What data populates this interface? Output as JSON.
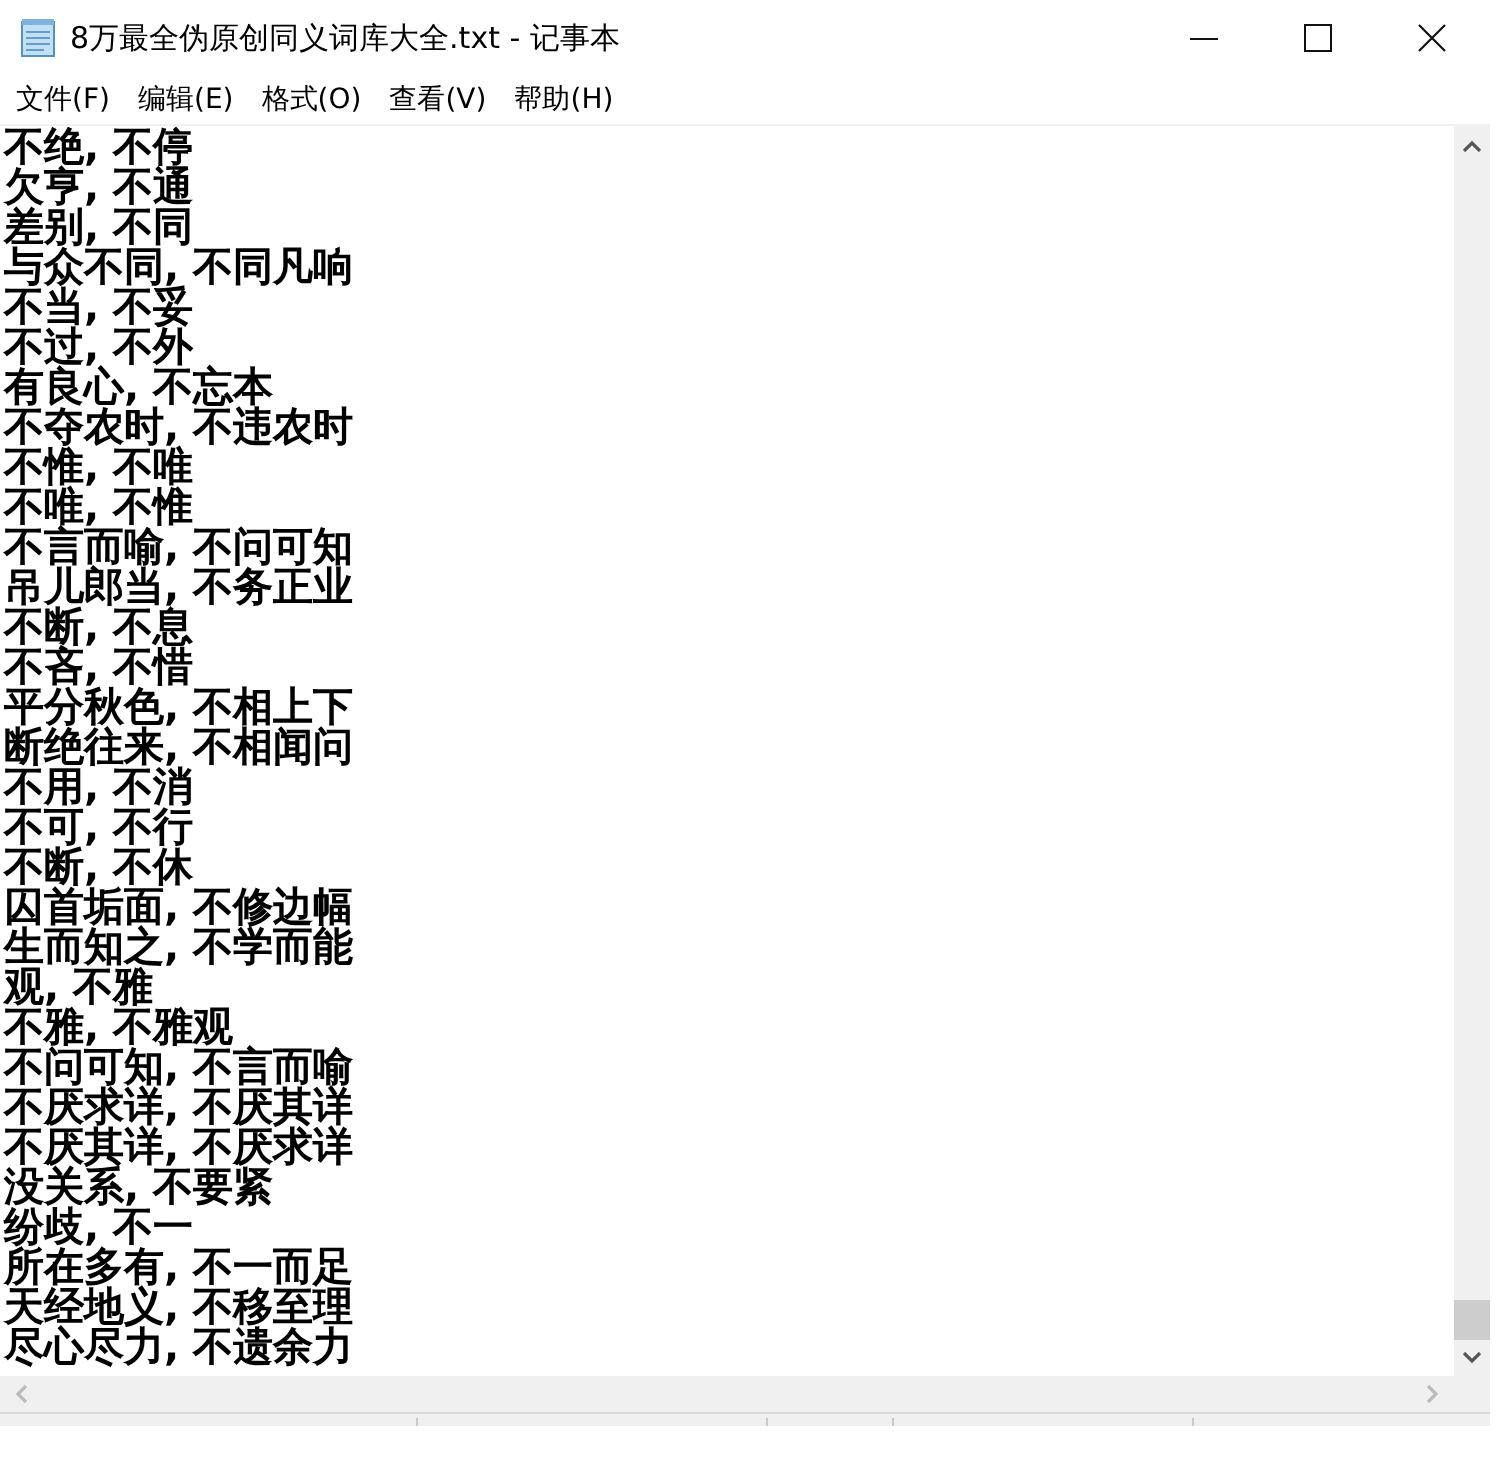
{
  "window": {
    "title": "8万最全伪原创同义词库大全.txt - 记事本"
  },
  "menu": [
    "文件(F)",
    "编辑(E)",
    "格式(O)",
    "查看(V)",
    "帮助(H)"
  ],
  "lines": [
    "不绝, 不停",
    "欠亨, 不通",
    "差别, 不同",
    "与众不同, 不同凡响",
    "不当, 不妥",
    "不过, 不外",
    "有良心, 不忘本",
    "不夺农时, 不违农时",
    "不惟, 不唯",
    "不唯, 不惟",
    "不言而喻, 不问可知",
    "吊儿郎当, 不务正业",
    "不断, 不息",
    "不吝, 不惜",
    "平分秋色, 不相上下",
    "断绝往来, 不相闻问",
    "不用, 不消",
    "不可, 不行",
    "不断, 不休",
    "囚首垢面, 不修边幅",
    "生而知之, 不学而能",
    "观, 不雅",
    "不雅, 不雅观",
    "不问可知, 不言而喻",
    "不厌求详, 不厌其详",
    "不厌其详, 不厌求详",
    "没关系, 不要紧",
    "纷歧, 不一",
    "所在多有, 不一而足",
    "天经地义, 不移至理",
    "尽心尽力, 不遗余力"
  ]
}
